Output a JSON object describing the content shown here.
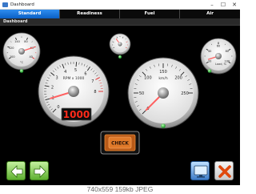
{
  "window": {
    "title": "Dashboard",
    "minimize": "–",
    "maximize": "☐",
    "close": "✕"
  },
  "tabs": [
    {
      "label": "Standard",
      "active": true
    },
    {
      "label": "Readiness",
      "active": false
    },
    {
      "label": "Fuel",
      "active": false
    },
    {
      "label": "Air",
      "active": false
    }
  ],
  "section_title": "Dashboard",
  "gauges": {
    "coolant": {
      "ticks": [
        "100",
        "120",
        "140",
        "80",
        "60",
        "40"
      ],
      "unit": "°C",
      "value_fraction": 0.8
    },
    "small_top": {
      "value_fraction": 0.35
    },
    "load": {
      "ticks": [
        "20",
        "40",
        "60",
        "80",
        "100"
      ],
      "unit": "Load, %",
      "value_fraction": 0.05
    },
    "rpm": {
      "ticks": [
        "0",
        "1",
        "2",
        "3",
        "4",
        "5",
        "6",
        "7",
        "8"
      ],
      "unit": "RPM x 1000",
      "display": "1000",
      "value": 1000,
      "max": 8000
    },
    "speed": {
      "ticks": [
        "0",
        "50",
        "100",
        "150",
        "200",
        "250"
      ],
      "unit": "km/h",
      "value": 0,
      "max": 250
    }
  },
  "check_engine": {
    "label": "CHECK"
  },
  "toolbar": {
    "back_icon": "arrow-left-icon",
    "forward_icon": "arrow-right-icon",
    "monitor_icon": "monitor-icon",
    "close_icon": "close-x-icon"
  },
  "colors": {
    "tab_active": "#1a73d9",
    "led_green": "#2ecc40",
    "digital_red": "#ff2a1a",
    "needle": "#ff6060"
  },
  "caption": "740x559  159kb  JPEG"
}
